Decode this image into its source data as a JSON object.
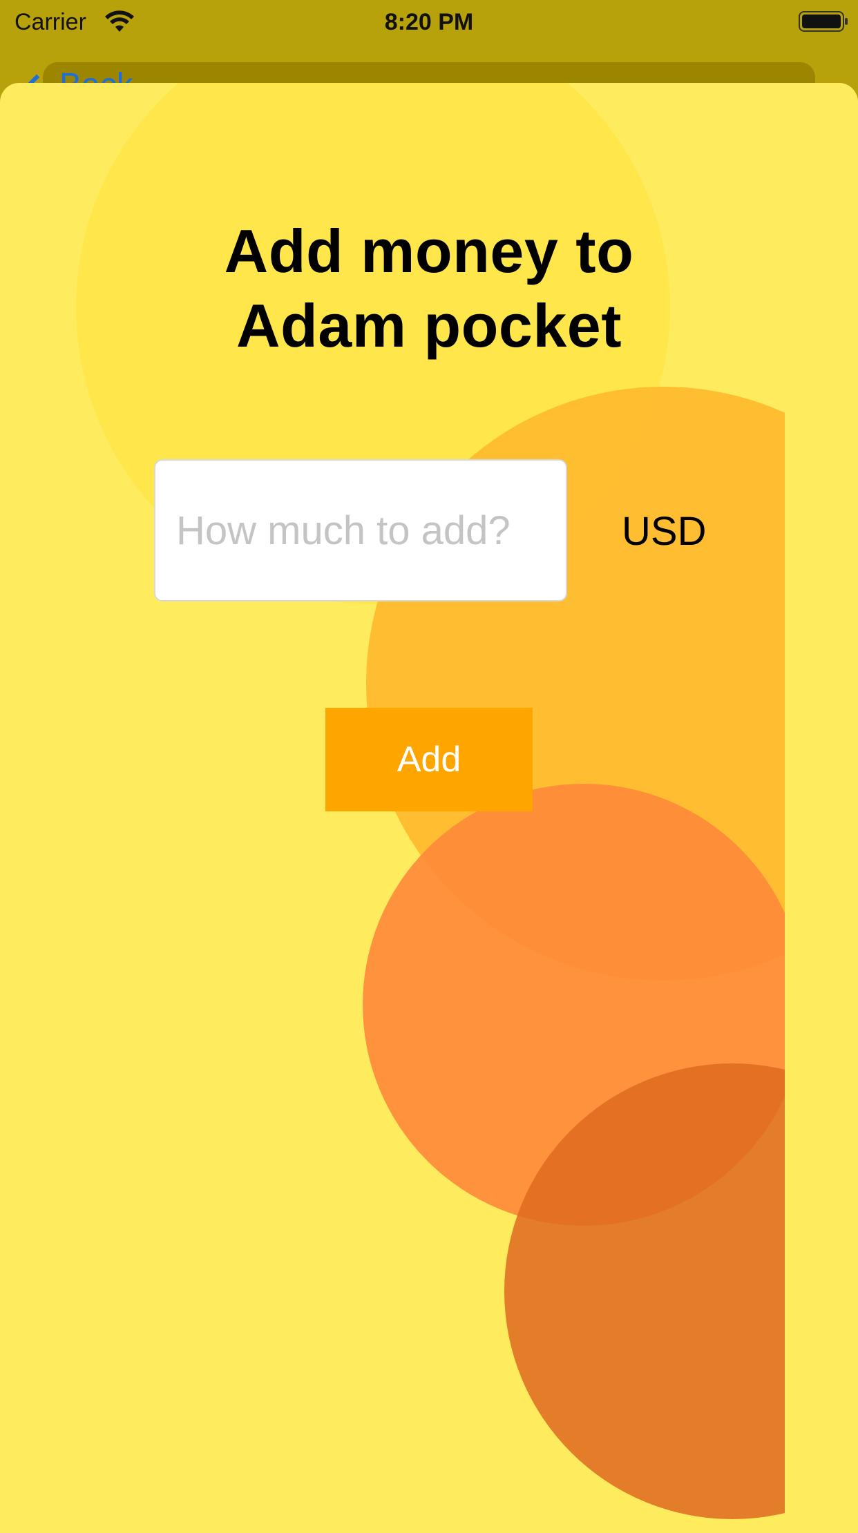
{
  "status_bar": {
    "carrier": "Carrier",
    "time": "8:20 PM"
  },
  "nav": {
    "back_label": "Back"
  },
  "sheet": {
    "title_line1": "Add money to",
    "title_line2": "Adam  pocket",
    "amount_placeholder": "How much to add?",
    "currency": "USD",
    "add_button_label": "Add"
  },
  "colors": {
    "sheet_background": "#FFEC5E",
    "status_bar_background": "#B8A20B",
    "add_button": "#FFA500",
    "back_link": "#1E6FD9"
  }
}
